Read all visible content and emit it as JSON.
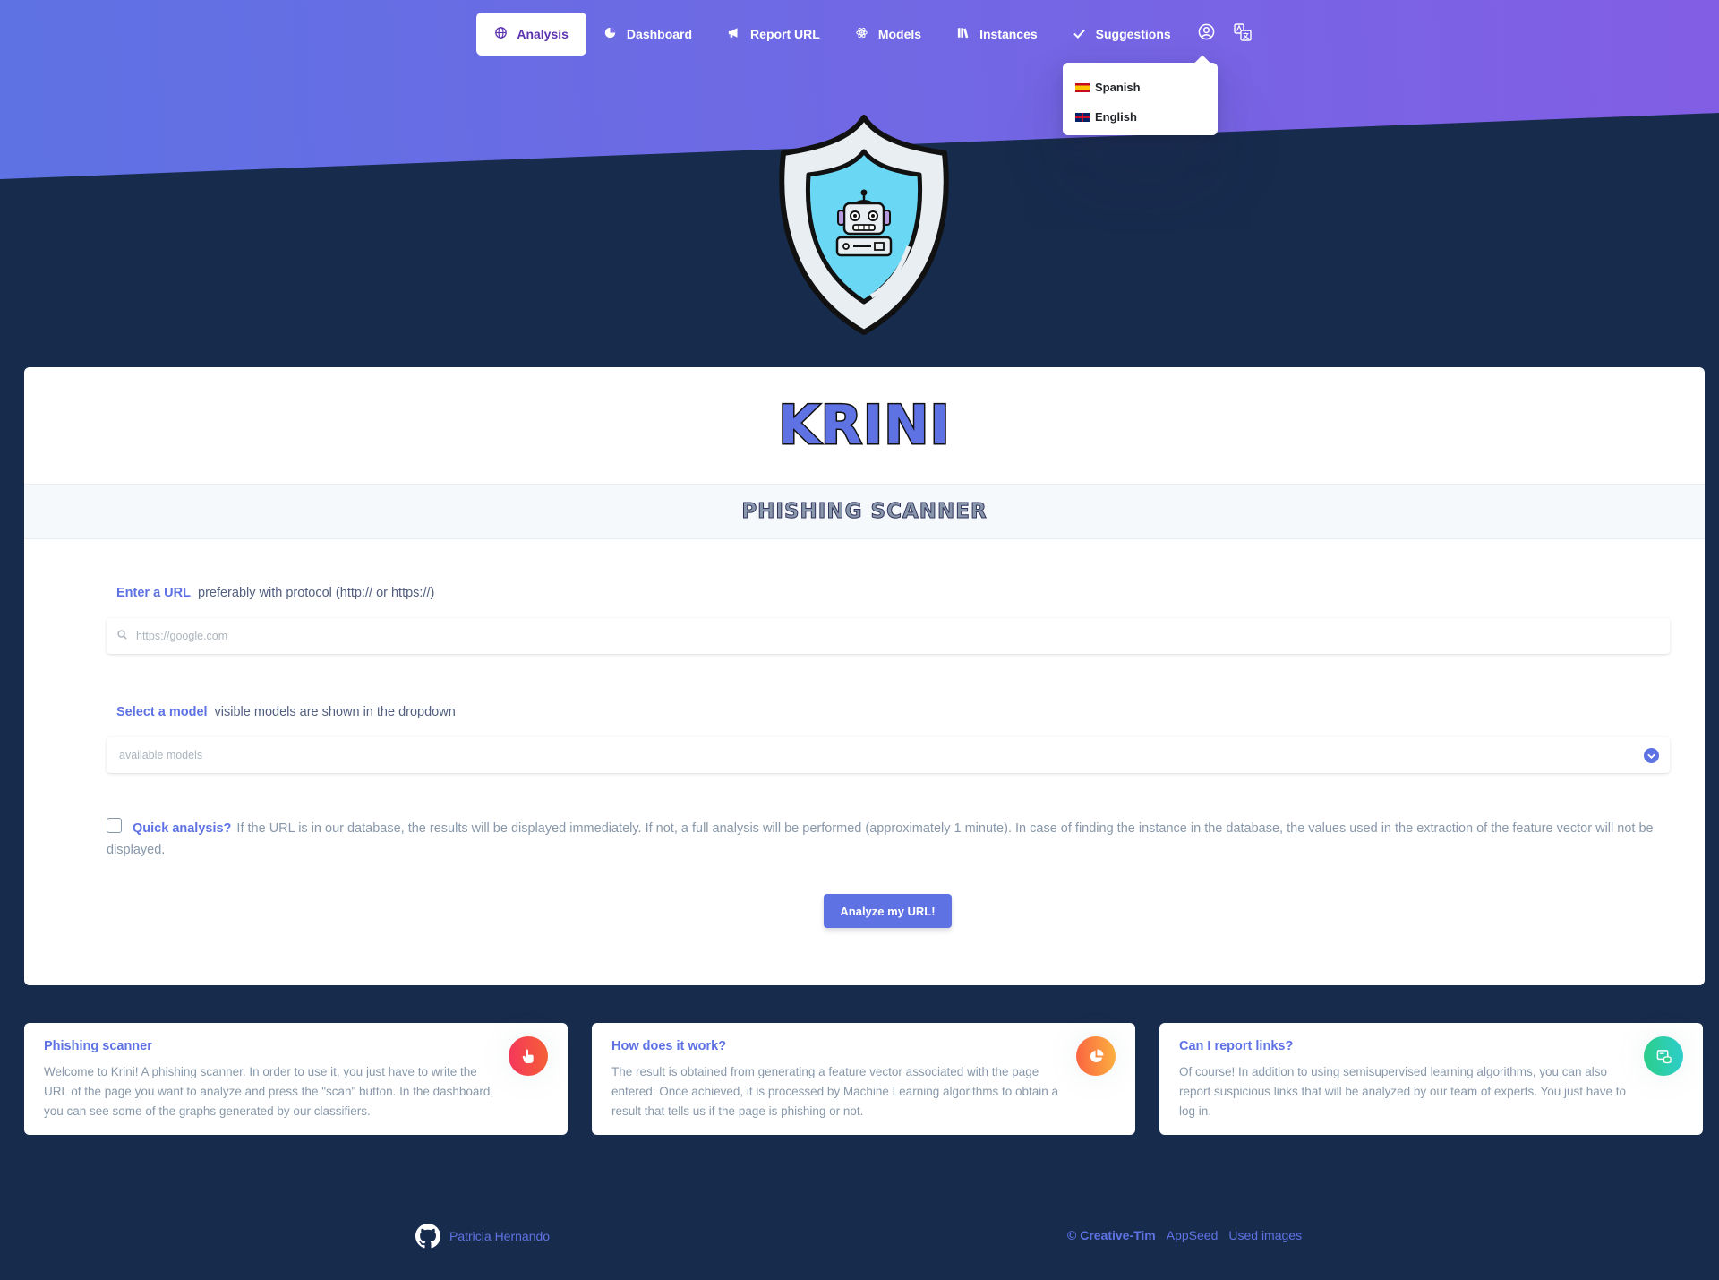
{
  "nav": {
    "items": [
      {
        "label": "Analysis",
        "icon": "globe-icon",
        "active": true
      },
      {
        "label": "Dashboard",
        "icon": "pie-chart-icon",
        "active": false
      },
      {
        "label": "Report URL",
        "icon": "megaphone-icon",
        "active": false
      },
      {
        "label": "Models",
        "icon": "atom-icon",
        "active": false
      },
      {
        "label": "Instances",
        "icon": "books-icon",
        "active": false
      },
      {
        "label": "Suggestions",
        "icon": "check-icon",
        "active": false
      }
    ],
    "user_icon": "user-circle-icon",
    "language_icon": "translate-icon"
  },
  "language_menu": {
    "items": [
      {
        "label": "Spanish",
        "flag": "spain-flag"
      },
      {
        "label": "English",
        "flag": "uk-flag"
      }
    ]
  },
  "card": {
    "brand": "KRINI",
    "subtitle": "PHISHING SCANNER",
    "url_field": {
      "label_strong": "Enter a URL",
      "label_hint": "preferably with protocol (http:// or https://)",
      "placeholder": "https://google.com"
    },
    "model_field": {
      "label_strong": "Select a model",
      "label_hint": "visible models are shown in the dropdown",
      "placeholder": "available models"
    },
    "quick": {
      "label": "Quick analysis?",
      "text": "If the URL is in our database, the results will be displayed immediately. If not, a full analysis will be performed (approximately 1 minute). In case of finding the instance in the database, the values used in the extraction of the feature vector will not be displayed.",
      "checked": false
    },
    "button": "Analyze my URL!"
  },
  "info_cards": [
    {
      "title": "Phishing scanner",
      "text": "Welcome to Krini! A phishing scanner. In order to use it, you just have to write the URL of the page you want to analyze and press the \"scan\" button. In the dashboard, you can see some of the graphs generated by our classifiers.",
      "icon": "hand-pointer-icon",
      "color": "#f5365c"
    },
    {
      "title": "How does it work?",
      "text": "The result is obtained from generating a feature vector associated with the page entered. Once achieved, it is processed by Machine Learning algorithms to obtain a result that tells us if the page is phishing or not.",
      "icon": "chart-pie-icon",
      "color": "#fb6340"
    },
    {
      "title": "Can I report links?",
      "text": "Of course! In addition to using semisupervised learning algorithms, you can also report suspicious links that will be analyzed by our team of experts. You just have to log in.",
      "icon": "database-icon",
      "color": "#2dce89"
    }
  ],
  "footer": {
    "author": "Patricia Hernando",
    "github_icon": "github-icon",
    "copyright": "© Creative-Tim",
    "appseed": "AppSeed",
    "images": "Used images"
  },
  "colors": {
    "primary": "#5e72e4",
    "background": "#172b4d",
    "gradient_start": "#5e72e4",
    "gradient_end": "#825ee4"
  }
}
